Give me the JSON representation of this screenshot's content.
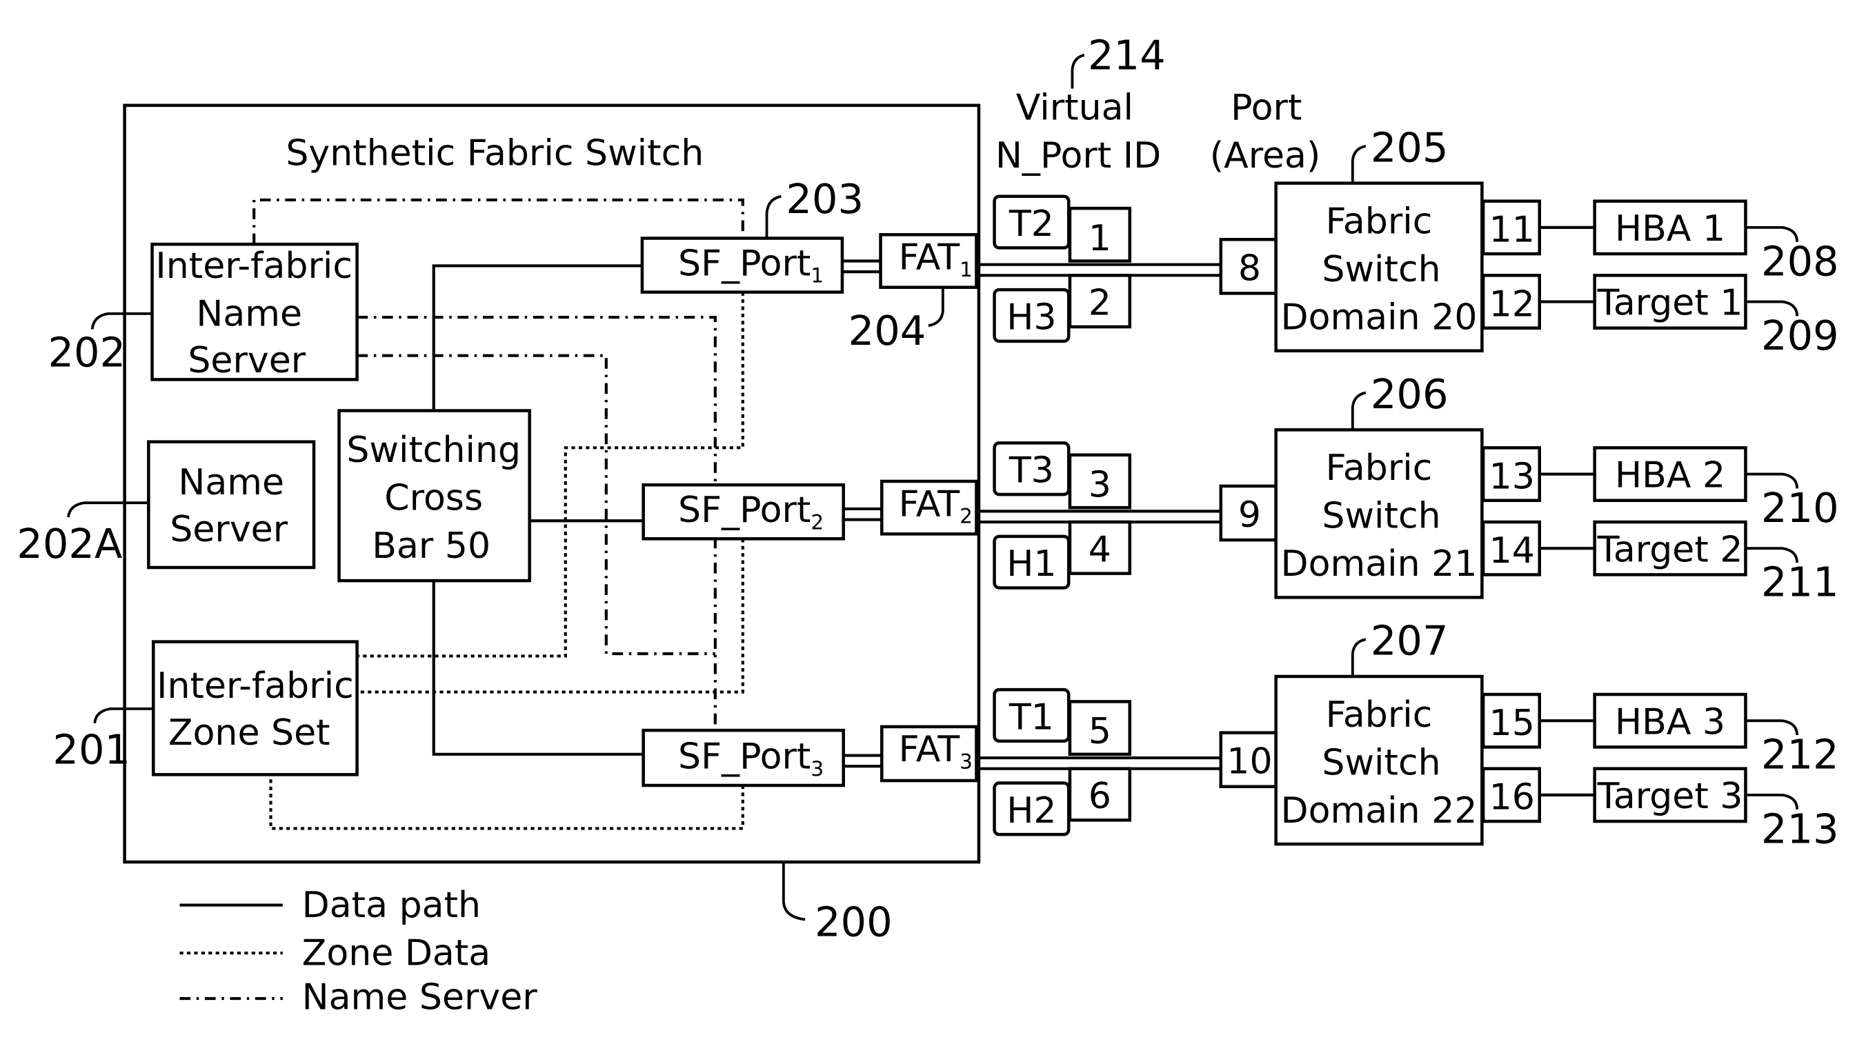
{
  "figure": {
    "title": "Synthetic Fabric Switch",
    "container_ref": "200",
    "column_headers": {
      "virtual_nport": [
        "Virtual",
        "N_Port ID"
      ],
      "virtual_nport_ref": "214",
      "port_area": [
        "Port",
        "(Area)"
      ]
    },
    "internal": {
      "name_server_if": {
        "lines": [
          "Inter-fabric",
          "Name",
          "Server"
        ],
        "ref": "202"
      },
      "name_server": {
        "lines": [
          "Name",
          "Server"
        ],
        "ref": "202A"
      },
      "crossbar": {
        "lines": [
          "Switching",
          "Cross",
          "Bar 50"
        ]
      },
      "zone_set": {
        "lines": [
          "Inter-fabric",
          "Zone Set"
        ],
        "ref": "201"
      },
      "sf_ports": [
        {
          "base": "SF_Port",
          "sub": "1",
          "ref": "203"
        },
        {
          "base": "SF_Port",
          "sub": "2"
        },
        {
          "base": "SF_Port",
          "sub": "3"
        }
      ],
      "fats": [
        {
          "base": "FAT",
          "sub": "1",
          "ref": "204"
        },
        {
          "base": "FAT",
          "sub": "2"
        },
        {
          "base": "FAT",
          "sub": "3"
        }
      ]
    },
    "rows": [
      {
        "top_dev": "T2",
        "top_vport": "1",
        "bot_dev": "H3",
        "bot_vport": "2",
        "area_port": "8",
        "switch_lines": [
          "Fabric",
          "Switch",
          "Domain 20"
        ],
        "switch_ref": "205",
        "out_ports": [
          "11",
          "12"
        ],
        "endpoints": [
          {
            "label": "HBA 1",
            "ref": "208"
          },
          {
            "label": "Target 1",
            "ref": "209"
          }
        ]
      },
      {
        "top_dev": "T3",
        "top_vport": "3",
        "bot_dev": "H1",
        "bot_vport": "4",
        "area_port": "9",
        "switch_lines": [
          "Fabric",
          "Switch",
          "Domain 21"
        ],
        "switch_ref": "206",
        "out_ports": [
          "13",
          "14"
        ],
        "endpoints": [
          {
            "label": "HBA 2",
            "ref": "210"
          },
          {
            "label": "Target 2",
            "ref": "211"
          }
        ]
      },
      {
        "top_dev": "T1",
        "top_vport": "5",
        "bot_dev": "H2",
        "bot_vport": "6",
        "area_port": "10",
        "switch_lines": [
          "Fabric",
          "Switch",
          "Domain 22"
        ],
        "switch_ref": "207",
        "out_ports": [
          "15",
          "16"
        ],
        "endpoints": [
          {
            "label": "HBA 3",
            "ref": "212"
          },
          {
            "label": "Target 3",
            "ref": "213"
          }
        ]
      }
    ],
    "legend": [
      {
        "style": "solid",
        "label": "Data path"
      },
      {
        "style": "dotted",
        "label": "Zone Data"
      },
      {
        "style": "dash-dot",
        "label": "Name Server"
      }
    ]
  }
}
